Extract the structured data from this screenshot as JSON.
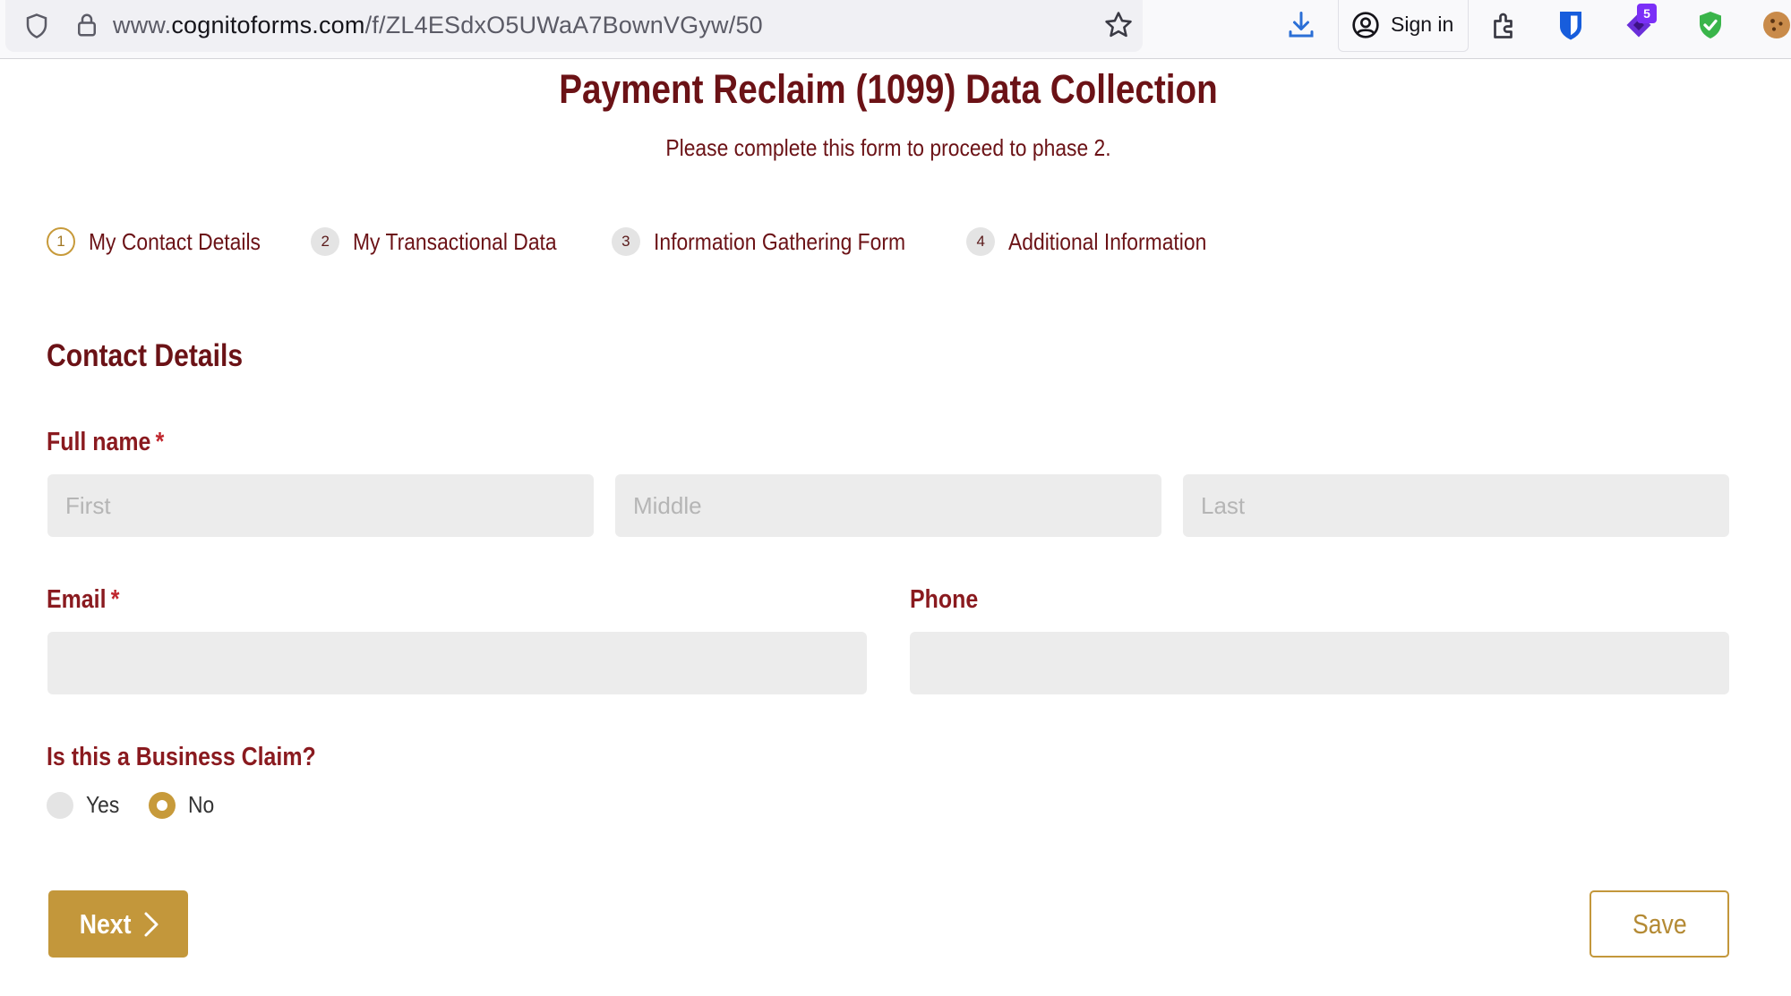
{
  "browser": {
    "url_prefix": "www.",
    "url_host": "cognitoforms.com",
    "url_path": "/f/ZL4ESdxO5UWaA7BownVGyw/50",
    "sign_in_label": "Sign in",
    "extension_badge": "5",
    "icons": [
      "shield-icon",
      "lock-icon",
      "bookmark-star-icon",
      "download-icon",
      "account-icon",
      "extensions-icon",
      "bitwarden-icon",
      "twitch-extension-icon",
      "adblock-shield-icon",
      "cookie-icon"
    ]
  },
  "form": {
    "title": "Payment Reclaim (1099) Data Collection",
    "description": "Please complete this form to proceed to phase 2.",
    "steps": [
      {
        "number": "1",
        "label": "My Contact Details",
        "active": true
      },
      {
        "number": "2",
        "label": "My Transactional Data",
        "active": false
      },
      {
        "number": "3",
        "label": "Information Gathering Form",
        "active": false
      },
      {
        "number": "4",
        "label": "Additional Information",
        "active": false
      }
    ],
    "section_title": "Contact Details",
    "full_name": {
      "label": "Full name",
      "required_mark": "*",
      "first_placeholder": "First",
      "middle_placeholder": "Middle",
      "last_placeholder": "Last"
    },
    "email": {
      "label": "Email",
      "required_mark": "*",
      "value": ""
    },
    "phone": {
      "label": "Phone",
      "value": ""
    },
    "business_claim": {
      "label": "Is this a Business Claim?",
      "options": [
        {
          "label": "Yes",
          "checked": false
        },
        {
          "label": "No",
          "checked": true
        }
      ]
    },
    "next_label": "Next",
    "save_label": "Save"
  },
  "colors": {
    "maroon": "#6b1216",
    "label_red": "#8a1a1f",
    "gold": "#c3973b",
    "input_bg": "#ececec"
  }
}
